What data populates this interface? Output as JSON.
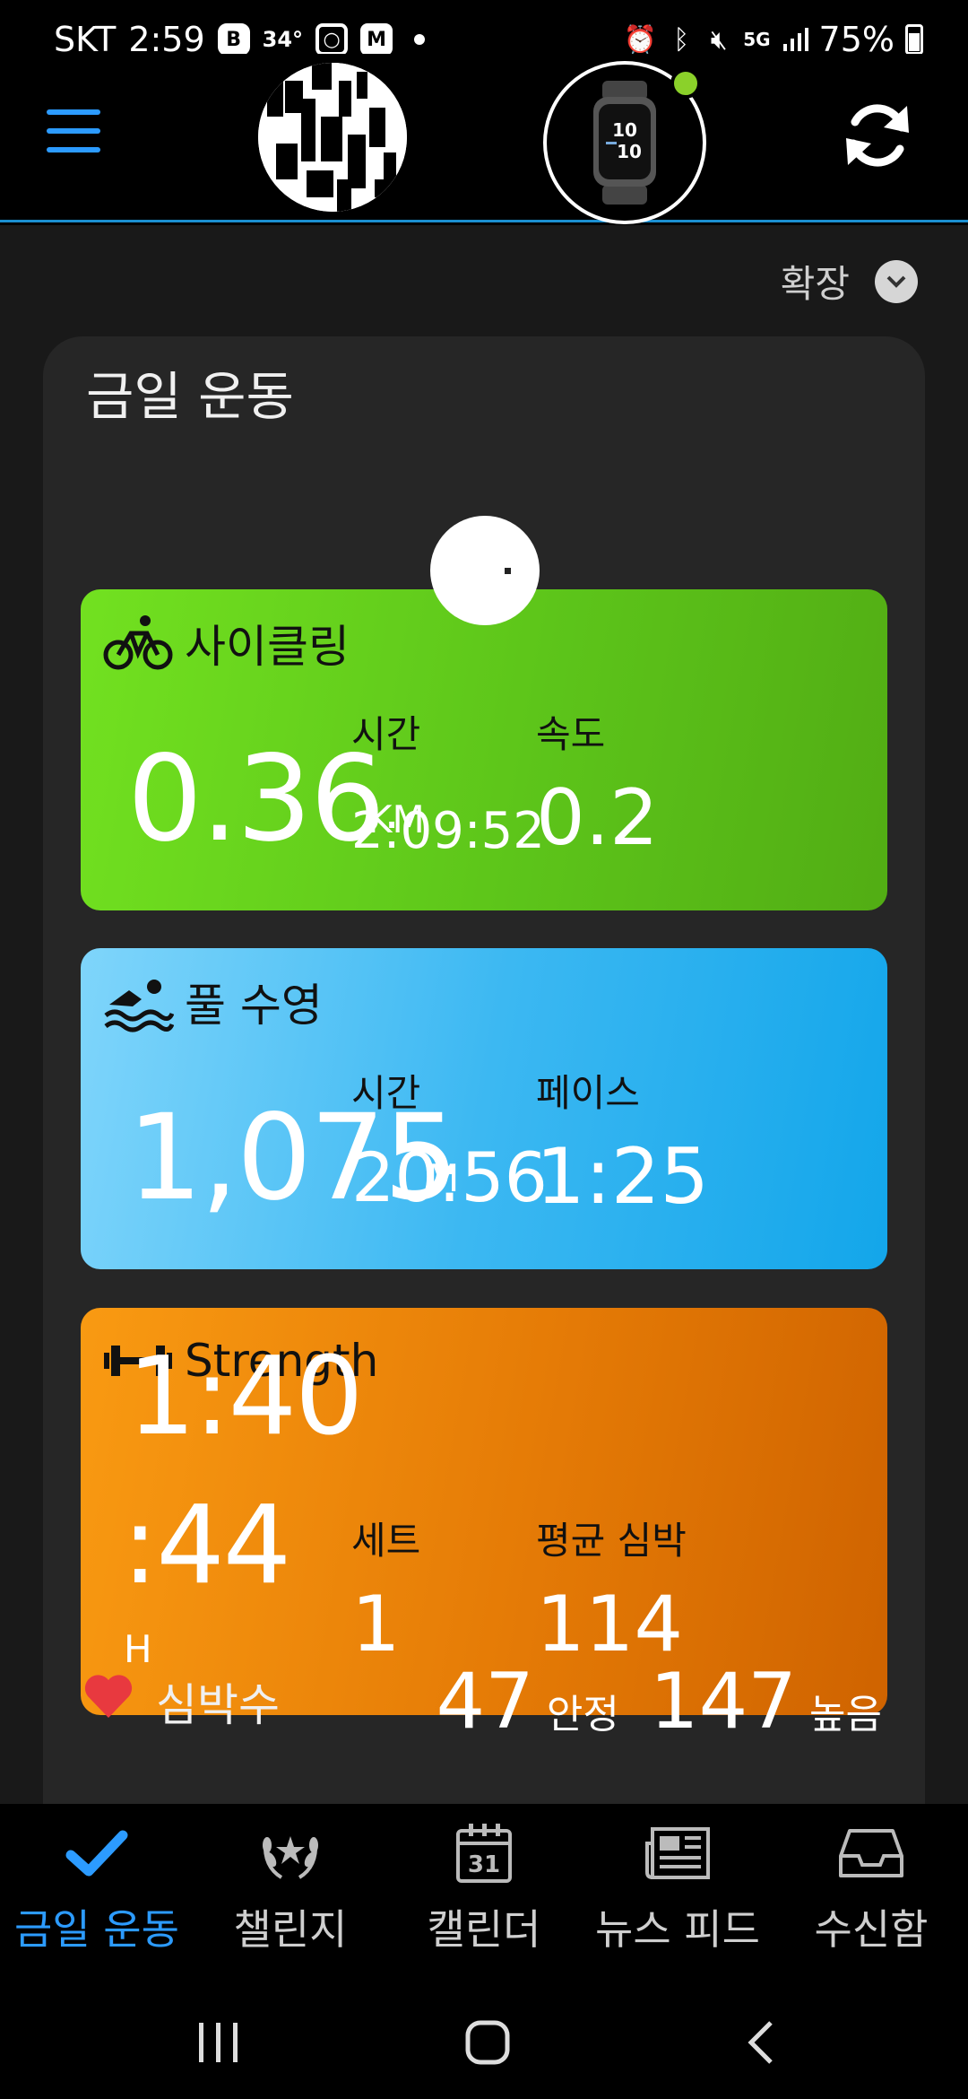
{
  "status_bar": {
    "carrier": "SKT",
    "time": "2:59",
    "temperature": "34°",
    "network": "5G",
    "battery": "75%",
    "icons": [
      "b-app-icon",
      "instagram-icon",
      "m-app-icon",
      "alarm-icon",
      "bluetooth-icon",
      "mute-icon",
      "signal-icon",
      "battery-icon"
    ]
  },
  "header": {
    "menu_icon": "hamburger-menu-icon",
    "sync_icon": "sync-icon",
    "device_status_color": "#8bd12a",
    "watch_time": "10 10"
  },
  "main": {
    "expand_label": "확장",
    "panel_title": "금일 운동",
    "cards": [
      {
        "activity": "사이클링",
        "icon": "bicycle-icon",
        "value": "0.36",
        "unit": "KM",
        "metric1_label": "시간",
        "metric1_value": "2:09:52",
        "metric2_label": "속도",
        "metric2_value": "0.2",
        "color": "#62cb1b"
      },
      {
        "activity": "풀 수영",
        "icon": "swimmer-icon",
        "value": "1,075",
        "unit": "M",
        "metric1_label": "시간",
        "metric1_value": "20:56",
        "metric2_label": "페이스",
        "metric2_value": "1:25",
        "color": "#23aeee"
      },
      {
        "activity": "Strength",
        "icon": "dumbbell-icon",
        "value_line1": "1:40",
        "value_line2": ":44",
        "unit": "H",
        "metric1_label": "세트",
        "metric1_value": "1",
        "metric2_label": "평균 심박",
        "metric2_value": "114",
        "color": "#e57b06"
      }
    ],
    "heart_rate": {
      "label": "심박수",
      "icon": "heart-icon",
      "resting_value": "47",
      "resting_label": "안정",
      "high_value": "147",
      "high_label": "높음"
    }
  },
  "tabs": [
    {
      "label": "금일 운동",
      "icon": "checkmark-icon",
      "active": true
    },
    {
      "label": "챌린지",
      "icon": "laurel-icon",
      "active": false
    },
    {
      "label": "캘린더",
      "icon": "calendar-icon",
      "calendar_day": "31",
      "active": false
    },
    {
      "label": "뉴스 피드",
      "icon": "newspaper-icon",
      "active": false
    },
    {
      "label": "수신함",
      "icon": "inbox-icon",
      "active": false
    }
  ],
  "system_nav": [
    "recent-apps-icon",
    "home-icon",
    "back-icon"
  ],
  "colors": {
    "accent": "#2c9bff",
    "divider": "#1b8fd1",
    "heart": "#e8393f"
  }
}
